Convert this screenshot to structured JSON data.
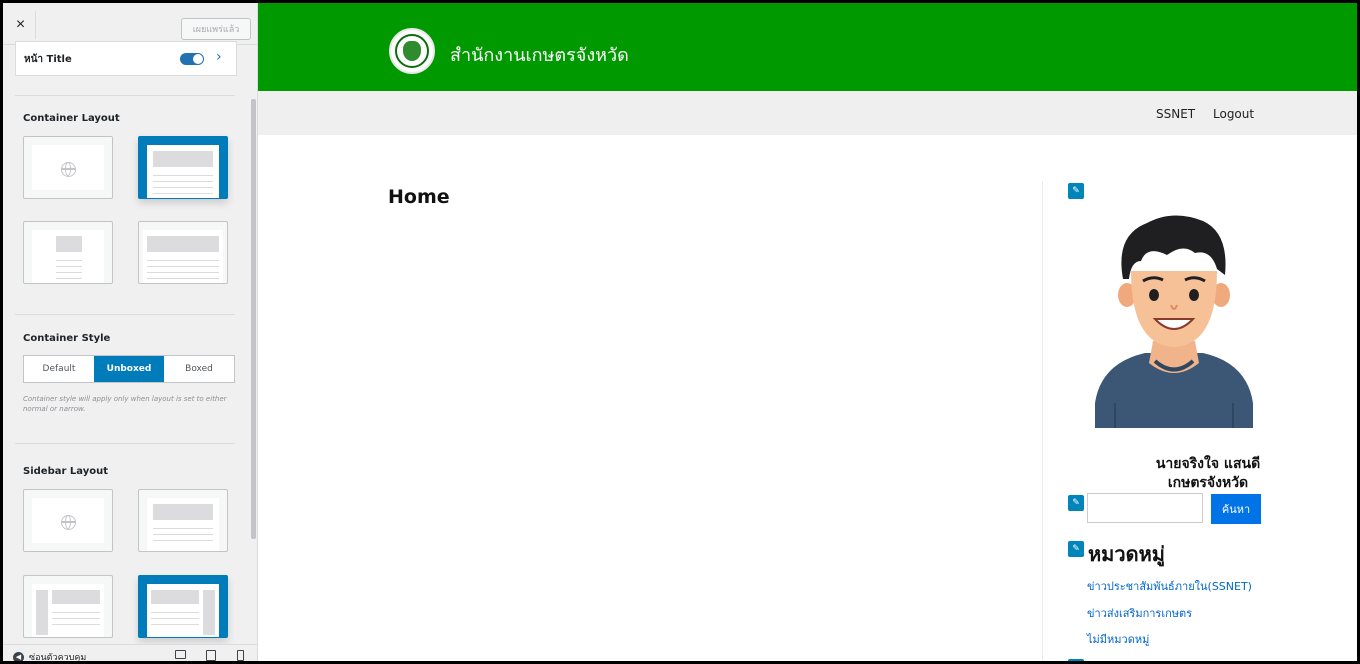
{
  "customizer": {
    "close_icon": "×",
    "publish_label": "เผยแพร่แล้ว",
    "page_title_label": "หน้า Title",
    "page_title_chevron": "›",
    "container_layout": {
      "title": "Container Layout"
    },
    "container_style": {
      "title": "Container Style",
      "options": [
        "Default",
        "Unboxed",
        "Boxed"
      ],
      "selected": "Unboxed",
      "help": "Container style will apply only when layout is set to either normal or narrow."
    },
    "sidebar_layout": {
      "title": "Sidebar Layout"
    },
    "footer": {
      "hide_label": "ซ่อนตัวควบคุม"
    }
  },
  "site": {
    "name": "สำนักงานเกษตรจังหวัด",
    "header_color": "#009900",
    "nav": {
      "ssnet": "SSNET",
      "logout": "Logout"
    },
    "page_heading": "Home",
    "sidebar": {
      "edit_icon": "✎",
      "author_name": "นายจริงใจ แสนดี",
      "author_role": "เกษตรจังหวัด",
      "search_button": "ค้นหา",
      "categories_heading": "หมวดหมู่",
      "categories": [
        "ข่าวประชาสัมพันธ์ภายใน(SSNET)",
        "ข่าวส่งเสริมการเกษตร",
        "ไม่มีหมวดหมู่"
      ],
      "next_heading": "..."
    }
  }
}
